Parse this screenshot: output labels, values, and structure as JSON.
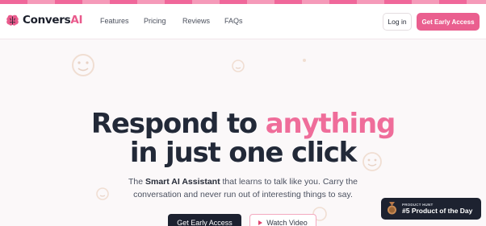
{
  "brand": {
    "name_dark": "Convers",
    "name_accent": "AI",
    "logo_icon": "brain-icon"
  },
  "nav": {
    "links": [
      "Features",
      "Pricing",
      "Reviews",
      "FAQs"
    ]
  },
  "header": {
    "login_label": "Log in",
    "cta_label": "Get Early Access"
  },
  "hero": {
    "title_part1": "Respond to ",
    "title_highlight": "anything",
    "title_line2": "in just one click",
    "subtitle_pre": "The ",
    "subtitle_bold": "Smart AI Assistant",
    "subtitle_post": " that learns to talk like you. Carry the",
    "subtitle_line2": "conversation and never run out of interesting things to say.",
    "primary_cta": "Get Early Access",
    "secondary_cta": "Watch Video"
  },
  "product_hunt": {
    "label_small": "PRODUCT HUNT",
    "label_main": "#5 Product of the Day",
    "icon": "medal-icon"
  },
  "colors": {
    "accent": "#ea5f8f",
    "dark": "#1c2130",
    "highlight": "#ef6d9a"
  }
}
